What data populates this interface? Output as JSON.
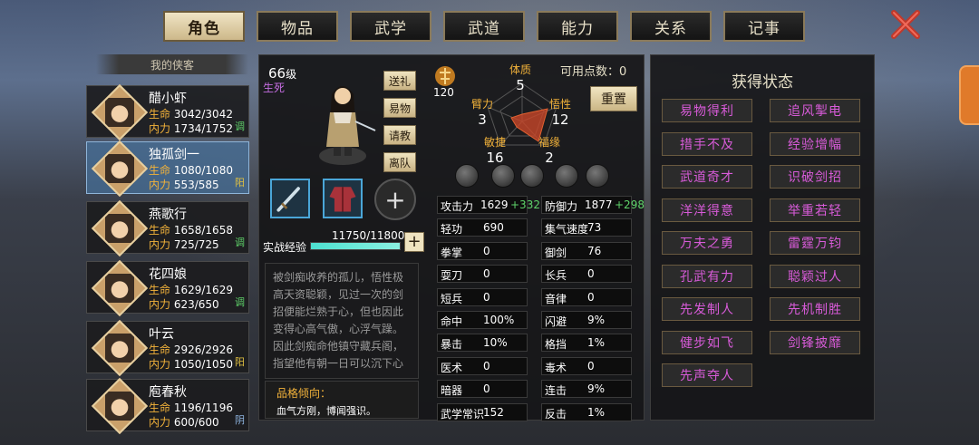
{
  "tabs": [
    "角色",
    "物品",
    "武学",
    "武道",
    "能力",
    "关系",
    "记事"
  ],
  "list_title": "我的侠客",
  "characters": [
    {
      "name": "醋小虾",
      "hp_label": "生命",
      "hp": "3042/3042",
      "mp_label": "内力",
      "mp": "1734/1752",
      "tag": "调",
      "tag_color": "#5fd36a"
    },
    {
      "name": "独孤剑一",
      "hp_label": "生命",
      "hp": "1080/1080",
      "mp_label": "内力",
      "mp": "553/585",
      "tag": "阳",
      "tag_color": "#e0c040"
    },
    {
      "name": "燕歌行",
      "hp_label": "生命",
      "hp": "1658/1658",
      "mp_label": "内力",
      "mp": "725/725",
      "tag": "调",
      "tag_color": "#5fd36a"
    },
    {
      "name": "花四娘",
      "hp_label": "生命",
      "hp": "1629/1629",
      "mp_label": "内力",
      "mp": "623/650",
      "tag": "调",
      "tag_color": "#5fd36a"
    },
    {
      "name": "叶云",
      "hp_label": "生命",
      "hp": "2926/2926",
      "mp_label": "内力",
      "mp": "1050/1050",
      "tag": "阳",
      "tag_color": "#e0c040"
    },
    {
      "name": "庖春秋",
      "hp_label": "生命",
      "hp": "1196/1196",
      "mp_label": "内力",
      "mp": "600/600",
      "tag": "阴",
      "tag_color": "#8fb5e0"
    }
  ],
  "profile": {
    "level": "66",
    "level_unit": "级",
    "status": "生死"
  },
  "actions": [
    "送礼",
    "易物",
    "请教",
    "离队"
  ],
  "exp": {
    "label": "实战经验",
    "value": "11750/11800",
    "fraction": 0.996
  },
  "bio": "被剑痴收养的孤儿，悟性极高天资聪颖，见过一次的剑招便能烂熟于心，但也因此变得心高气傲，心浮气躁。因此剑痴命他镇守藏兵阁，指望他有朝一日可以沉下心",
  "personality": {
    "title": "品格倾向：",
    "value": "血气方刚，博闻强识。"
  },
  "points": {
    "icon_value": "120",
    "available_label": "可用点数：",
    "available": "0",
    "reset": "重置"
  },
  "attributes": [
    {
      "name": "体质",
      "value": "5"
    },
    {
      "name": "臂力",
      "value": "3"
    },
    {
      "name": "悟性",
      "value": "12"
    },
    {
      "name": "敏捷",
      "value": "16"
    },
    {
      "name": "福缘",
      "value": "2"
    }
  ],
  "stats": [
    {
      "k": "攻击力",
      "v": "1629",
      "b": "+332"
    },
    {
      "k": "防御力",
      "v": "1877",
      "b": "+298"
    },
    {
      "k": "轻功",
      "v": "690"
    },
    {
      "k": "集气速度",
      "v": "73"
    },
    {
      "k": "拳掌",
      "v": "0"
    },
    {
      "k": "御剑",
      "v": "76"
    },
    {
      "k": "耍刀",
      "v": "0"
    },
    {
      "k": "长兵",
      "v": "0"
    },
    {
      "k": "短兵",
      "v": "0"
    },
    {
      "k": "音律",
      "v": "0"
    },
    {
      "k": "命中",
      "v": "100%"
    },
    {
      "k": "闪避",
      "v": "9%"
    },
    {
      "k": "暴击",
      "v": "10%"
    },
    {
      "k": "格挡",
      "v": "1%"
    },
    {
      "k": "医术",
      "v": "0"
    },
    {
      "k": "毒术",
      "v": "0"
    },
    {
      "k": "暗器",
      "v": "0"
    },
    {
      "k": "连击",
      "v": "9%"
    },
    {
      "k": "武学常识",
      "v": "152"
    },
    {
      "k": "反击",
      "v": "1%"
    }
  ],
  "status_title": "获得状态",
  "statuses": [
    "易物得利",
    "追风掣电",
    "措手不及",
    "经验增幅",
    "武道奇才",
    "识破剑招",
    "洋洋得意",
    "举重若轻",
    "万夫之勇",
    "雷霆万钧",
    "孔武有力",
    "聪颖过人",
    "先发制人",
    "先机制胜",
    "健步如飞",
    "剑锋披靡",
    "先声夺人"
  ],
  "colors": {
    "status_text": "#d85bd9",
    "stat_bonus": "#5fd36a",
    "accent_gold": "#f2b23a"
  }
}
